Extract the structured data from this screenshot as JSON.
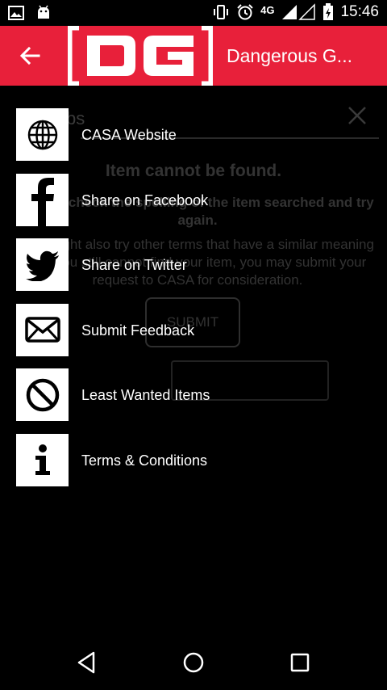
{
  "status_bar": {
    "time": "15:46",
    "network": "4G",
    "icons": [
      "image-icon",
      "android-icon",
      "vibrate-icon",
      "alarm-icon",
      "signal-icon",
      "battery-charging-icon"
    ]
  },
  "toolbar": {
    "logo_text": "DG",
    "title": "Dangerous G...",
    "color": "#e8203a"
  },
  "background": {
    "tab_label": "bs",
    "heading": "Item cannot be found.",
    "para1": "Please check the spelling of the item searched and try again.",
    "para2": "You might also try other terms that have a similar meaning or if you still cannot find your item, you may submit your request to CASA for consideration.",
    "submit_label": "SUBMIT"
  },
  "menu": {
    "items": [
      {
        "label": "CASA Website",
        "icon": "globe-icon"
      },
      {
        "label": "Share on Facebook",
        "icon": "facebook-icon"
      },
      {
        "label": "Share on Twitter",
        "icon": "twitter-icon"
      },
      {
        "label": "Submit Feedback",
        "icon": "envelope-icon"
      },
      {
        "label": "Least Wanted Items",
        "icon": "prohibited-icon"
      },
      {
        "label": "Terms & Conditions",
        "icon": "info-icon"
      }
    ]
  },
  "navbar": {
    "icons": [
      "back-icon",
      "home-icon",
      "recents-icon"
    ]
  }
}
